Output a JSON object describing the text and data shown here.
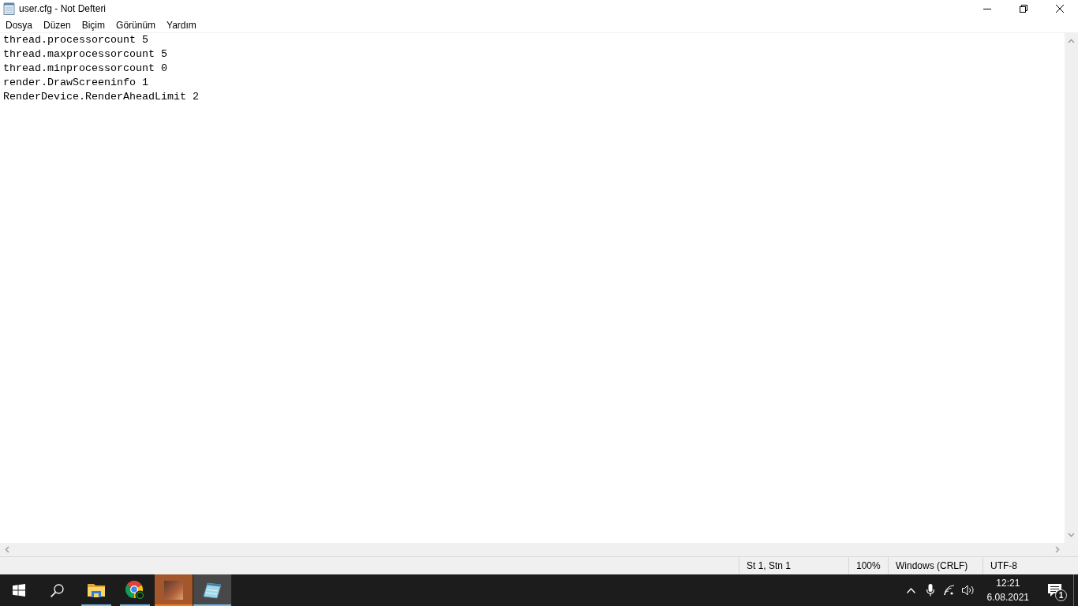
{
  "window": {
    "title": "user.cfg - Not Defteri"
  },
  "menu": [
    "Dosya",
    "Düzen",
    "Biçim",
    "Görünüm",
    "Yardım"
  ],
  "editor": {
    "lines": [
      "thread.processorcount 5",
      "thread.maxprocessorcount 5",
      "thread.minprocessorcount 0",
      "render.DrawScreeninfo 1",
      "RenderDevice.RenderAheadLimit 2"
    ]
  },
  "status_bar": {
    "position": "St 1, Stn 1",
    "zoom": "100%",
    "line_ending": "Windows (CRLF)",
    "encoding": "UTF-8"
  },
  "taskbar": {
    "apps": [
      {
        "kind": "folder",
        "selected": false,
        "attention": false
      },
      {
        "kind": "browser",
        "selected": false,
        "attention": false
      },
      {
        "kind": "picture",
        "selected": false,
        "attention": true
      },
      {
        "kind": "notepad",
        "selected": true,
        "attention": false
      }
    ],
    "clock": {
      "time": "12:21",
      "date": "6.08.2021"
    },
    "notifications": {
      "count": "1"
    }
  }
}
